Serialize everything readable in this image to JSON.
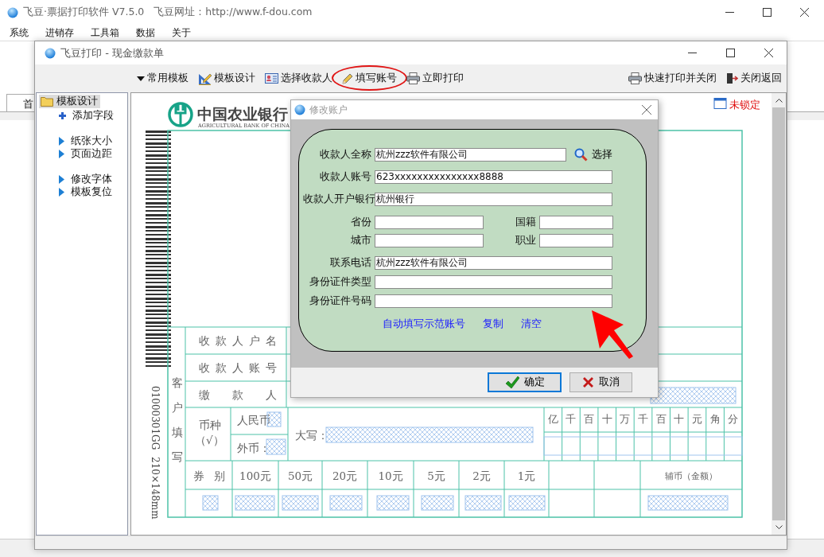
{
  "app_window": {
    "title": "飞豆·票据打印软件 V7.5.0",
    "site": "飞豆网址：http://www.f-dou.com",
    "menu": [
      "系统",
      "进销存",
      "工具箱",
      "数据",
      "关于"
    ],
    "tab": "首"
  },
  "print_window": {
    "title": "飞豆打印 - 现金缴款单",
    "toolbar": [
      {
        "label": "常用模板",
        "highlighted": false
      },
      {
        "label": "模板设计",
        "highlighted": false
      },
      {
        "label": "选择收款人",
        "highlighted": false
      },
      {
        "label": "填写账号",
        "highlighted": true
      },
      {
        "label": "立即打印",
        "highlighted": false
      }
    ],
    "toolbar_right": [
      {
        "label": "快速打印并关闭",
        "highlighted": false
      },
      {
        "label": "关闭返回",
        "highlighted": false
      }
    ]
  },
  "sidebar": {
    "root": {
      "label": "模板设计",
      "selected": true
    },
    "groups": [
      [
        {
          "label": "添加字段",
          "selected": false
        }
      ],
      [
        {
          "label": "纸张大小",
          "selected": false
        },
        {
          "label": "页面边距",
          "selected": false
        }
      ],
      [
        {
          "label": "修改字体",
          "selected": false
        },
        {
          "label": "模板复位",
          "selected": false
        }
      ]
    ]
  },
  "form": {
    "lock_status": "未锁定",
    "bank_name": "中国农业银行",
    "bank_name_en": "AGRICULTURAL BANK OF CHINA",
    "serial": "01000301GG",
    "paper_size": "210×148mm",
    "side_label": "客户填写",
    "rows": [
      "收款人户名",
      "收款人账号",
      "缴款人"
    ],
    "currency_label": "币种",
    "currency_hint": "（√）",
    "rmb_label": "人民币",
    "foreign_label": "外币：",
    "amount_words_label": "大写：",
    "amount_units": [
      "亿",
      "千",
      "百",
      "十",
      "万",
      "千",
      "百",
      "十",
      "元",
      "角",
      "分"
    ],
    "denomination_label": "券别",
    "denominations": [
      "100元",
      "50元",
      "20元",
      "10元",
      "5元",
      "2元",
      "1元"
    ],
    "coin_label": "辅币（金额）"
  },
  "dialog": {
    "title": "修改账户",
    "rows": [
      [
        {
          "label": "收款人全称",
          "value": "杭州zzz软件有限公司",
          "action": "选择",
          "highlighted": false
        }
      ],
      [
        {
          "label": "收款人账号",
          "value": "623xxxxxxxxxxxxxxx8888",
          "highlighted": false
        }
      ],
      [
        {
          "label": "收款人开户银行",
          "value": "杭州银行",
          "highlighted": false
        }
      ],
      [
        {
          "label": "省份",
          "highlighted": false
        },
        {
          "label": "国籍",
          "highlighted": false
        }
      ],
      [
        {
          "label": "城市",
          "highlighted": false
        },
        {
          "label": "职业",
          "highlighted": false
        }
      ],
      [
        {
          "label": "联系电话",
          "value": "杭州zzz软件有限公司",
          "highlighted": false
        }
      ],
      [
        {
          "label": "身份证件类型",
          "highlighted": false
        }
      ],
      [
        {
          "label": "身份证件号码",
          "highlighted": true
        }
      ]
    ],
    "links": [
      "自动填写示范账号",
      "复制",
      "清空"
    ],
    "ok": "确定",
    "cancel": "取消"
  }
}
